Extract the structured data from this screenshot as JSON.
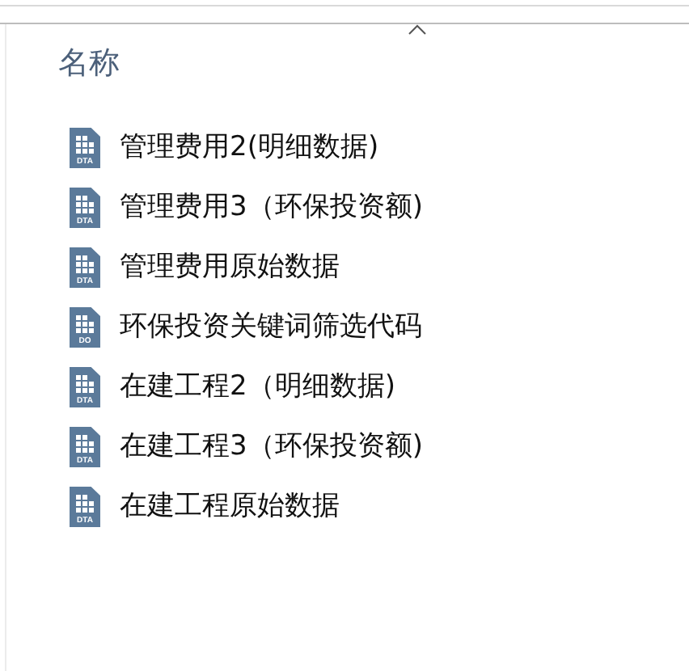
{
  "column_header": {
    "label": "名称",
    "sorted_ascending": true
  },
  "files": [
    {
      "name": "管理费用2(明细数据)",
      "badge": "DTA"
    },
    {
      "name": "管理费用3（环保投资额)",
      "badge": "DTA"
    },
    {
      "name": "管理费用原始数据",
      "badge": "DTA"
    },
    {
      "name": "环保投资关键词筛选代码",
      "badge": "DO"
    },
    {
      "name": "在建工程2（明细数据)",
      "badge": "DTA"
    },
    {
      "name": "在建工程3（环保投资额)",
      "badge": "DTA"
    },
    {
      "name": "在建工程原始数据",
      "badge": "DTA"
    }
  ]
}
